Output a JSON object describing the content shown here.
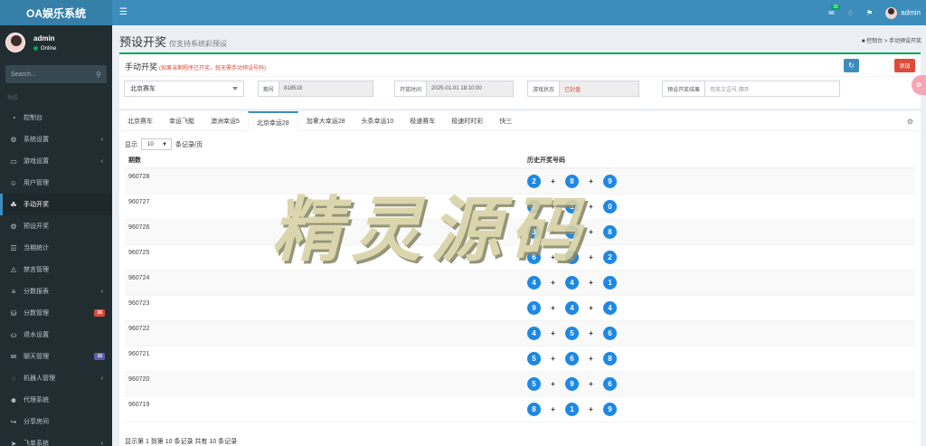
{
  "app": {
    "title": "OA娱乐系统"
  },
  "user": {
    "name": "admin",
    "status": "Online"
  },
  "sidebar": {
    "search_placeholder": "Search...",
    "nav_header": "导航",
    "items": [
      {
        "label": "控制台",
        "icon": "dashboard-icon",
        "active": false
      },
      {
        "label": "系统设置",
        "icon": "cogs-icon",
        "active": false,
        "chevron": true
      },
      {
        "label": "游戏设置",
        "icon": "gamepad-icon",
        "active": false,
        "chevron": true
      },
      {
        "label": "用户管理",
        "icon": "users-icon",
        "active": false
      },
      {
        "label": "手动开奖",
        "icon": "sitemap-icon",
        "active": true
      },
      {
        "label": "预设开奖",
        "icon": "gear-icon",
        "active": false
      },
      {
        "label": "当期统计",
        "icon": "stats-icon",
        "active": false
      },
      {
        "label": "禁言管理",
        "icon": "warning-icon",
        "active": false
      },
      {
        "label": "分数报表",
        "icon": "list-icon",
        "active": false,
        "chevron": true
      },
      {
        "label": "分数管理",
        "icon": "database-icon",
        "active": false,
        "badge": "36",
        "badge_color": "#dd4b39"
      },
      {
        "label": "退水设置",
        "icon": "coins-icon",
        "active": false
      },
      {
        "label": "聊天管理",
        "icon": "chat-icon",
        "active": false,
        "badge": "15",
        "badge_color": "#605ca8"
      },
      {
        "label": "机器人管理",
        "icon": "comment-icon",
        "active": false,
        "chevron": true
      },
      {
        "label": "代理系统",
        "icon": "user-plus-icon",
        "active": false
      },
      {
        "label": "分享房间",
        "icon": "share-icon",
        "active": false
      },
      {
        "label": "飞单系统",
        "icon": "paper-plane-icon",
        "active": false,
        "chevron": true
      }
    ]
  },
  "topbar": {
    "mail_count": "36",
    "user_name": "admin"
  },
  "page": {
    "title": "预设开奖",
    "subtitle": "仅支持系统彩预设"
  },
  "breadcrumb": {
    "home": "控制台",
    "current": "手动预设开奖"
  },
  "form": {
    "title": "手动开奖",
    "warning": "(如果当期程序已开奖，就无需手动预设号码)",
    "add_label": "添加",
    "game_select": "北京赛车",
    "period_label": "期号",
    "period_value": "818518",
    "time_label": "开奖时间",
    "time_value": "2025-01-01 18:10:00",
    "status_label": "游戏状态",
    "status_value": "已封盘",
    "preset_label": "预设开奖结果",
    "preset_placeholder": "用英文逗号,隔开"
  },
  "tabs": [
    {
      "label": "北京赛车",
      "active": false
    },
    {
      "label": "幸运飞艇",
      "active": false
    },
    {
      "label": "澳洲幸运5",
      "active": false
    },
    {
      "label": "北京幸运28",
      "active": true
    },
    {
      "label": "加拿大幸运28",
      "active": false
    },
    {
      "label": "头条幸运10",
      "active": false
    },
    {
      "label": "极速赛车",
      "active": false
    },
    {
      "label": "极速时时彩",
      "active": false
    },
    {
      "label": "快三",
      "active": false
    }
  ],
  "table": {
    "show_label": "显示",
    "page_size": "10",
    "per_page_label": "条记录/页",
    "col_period": "期数",
    "col_history": "历史开奖号码",
    "rows": [
      {
        "period": "960728",
        "numbers": [
          "2",
          "8",
          "9"
        ]
      },
      {
        "period": "960727",
        "numbers": [
          "1",
          "1",
          "0"
        ]
      },
      {
        "period": "960726",
        "numbers": [
          "3",
          "1",
          "8"
        ]
      },
      {
        "period": "960725",
        "numbers": [
          "6",
          "1",
          "2"
        ]
      },
      {
        "period": "960724",
        "numbers": [
          "4",
          "4",
          "1"
        ]
      },
      {
        "period": "960723",
        "numbers": [
          "9",
          "4",
          "4"
        ]
      },
      {
        "period": "960722",
        "numbers": [
          "4",
          "5",
          "6"
        ]
      },
      {
        "period": "960721",
        "numbers": [
          "5",
          "6",
          "8"
        ]
      },
      {
        "period": "960720",
        "numbers": [
          "5",
          "9",
          "6"
        ]
      },
      {
        "period": "960719",
        "numbers": [
          "8",
          "1",
          "9"
        ]
      }
    ],
    "info": "显示第 1 到第 10 条记录 共有 10 条记录"
  },
  "watermark": "精灵源码",
  "colors": {
    "accent": "#3c8dbc",
    "success": "#00a65a",
    "danger": "#dd4b39",
    "ball": "#1e88e5",
    "sidebar": "#222d32"
  }
}
